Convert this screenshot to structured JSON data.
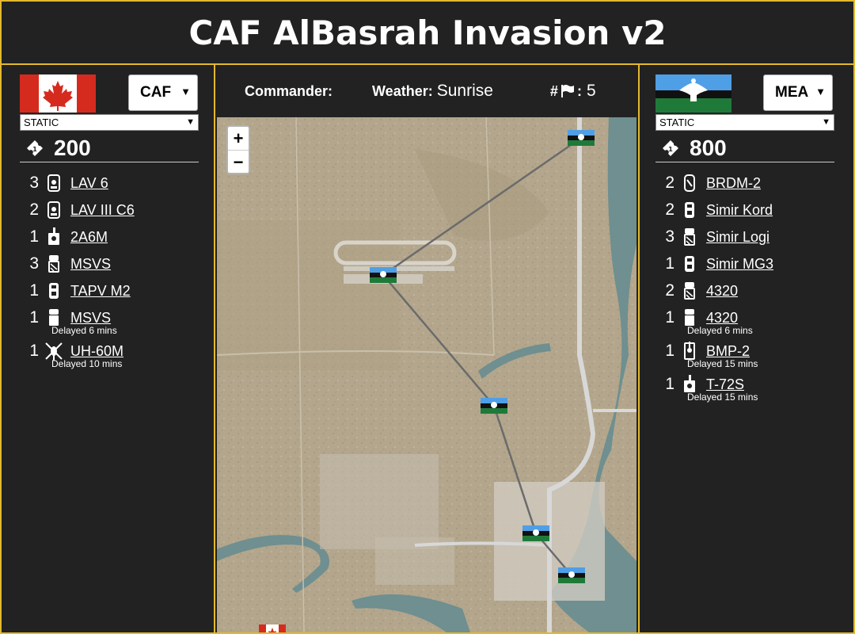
{
  "title": "CAF AlBasrah Invasion v2",
  "left_team": {
    "faction": "CAF",
    "mode": "STATIC",
    "tickets": "200",
    "flag_colors": {
      "red": "#d52b1e",
      "white": "#ffffff"
    },
    "units": [
      {
        "count": "3",
        "name": "LAV 6",
        "icon": "apc-icon",
        "delay": ""
      },
      {
        "count": "2",
        "name": "LAV III C6",
        "icon": "apc-icon",
        "delay": ""
      },
      {
        "count": "1",
        "name": "2A6M",
        "icon": "tank-icon",
        "delay": ""
      },
      {
        "count": "3",
        "name": "MSVS",
        "icon": "truck-icon",
        "delay": ""
      },
      {
        "count": "1",
        "name": "TAPV M2",
        "icon": "mrap-icon",
        "delay": ""
      },
      {
        "count": "1",
        "name": "MSVS",
        "icon": "logi-truck-icon",
        "delay": "Delayed 6 mins"
      },
      {
        "count": "1",
        "name": "UH-60M",
        "icon": "helicopter-icon",
        "delay": "Delayed 10 mins"
      }
    ]
  },
  "right_team": {
    "faction": "MEA",
    "mode": "STATIC",
    "tickets": "800",
    "flag_colors": {
      "blue": "#4f9fe6",
      "black": "#111111",
      "green": "#1f7a3a",
      "white": "#ffffff"
    },
    "units": [
      {
        "count": "2",
        "name": "BRDM-2",
        "icon": "scout-car-icon",
        "delay": ""
      },
      {
        "count": "2",
        "name": "Simir Kord",
        "icon": "mrap-icon",
        "delay": ""
      },
      {
        "count": "3",
        "name": "Simir Logi",
        "icon": "truck-icon",
        "delay": ""
      },
      {
        "count": "1",
        "name": "Simir MG3",
        "icon": "mrap-icon",
        "delay": ""
      },
      {
        "count": "2",
        "name": "4320",
        "icon": "truck-icon",
        "delay": ""
      },
      {
        "count": "1",
        "name": "4320",
        "icon": "logi-truck-icon",
        "delay": "Delayed 6 mins"
      },
      {
        "count": "1",
        "name": "BMP-2",
        "icon": "ifv-icon",
        "delay": "Delayed 15 mins"
      },
      {
        "count": "1",
        "name": "T-72S",
        "icon": "tank-icon",
        "delay": "Delayed 15 mins"
      }
    ]
  },
  "info": {
    "commander_label": "Commander:",
    "commander_value": "",
    "weather_label": "Weather:",
    "weather_value": "Sunrise",
    "flags_label": "#",
    "flags_sep": ":",
    "flags_value": "5"
  },
  "map": {
    "zoom_in": "+",
    "zoom_out": "−",
    "terrain_color": "#b3a68c",
    "water_color": "#6f8f90",
    "road_color": "#d8d8d8",
    "link_color": "#6b6b6b"
  }
}
